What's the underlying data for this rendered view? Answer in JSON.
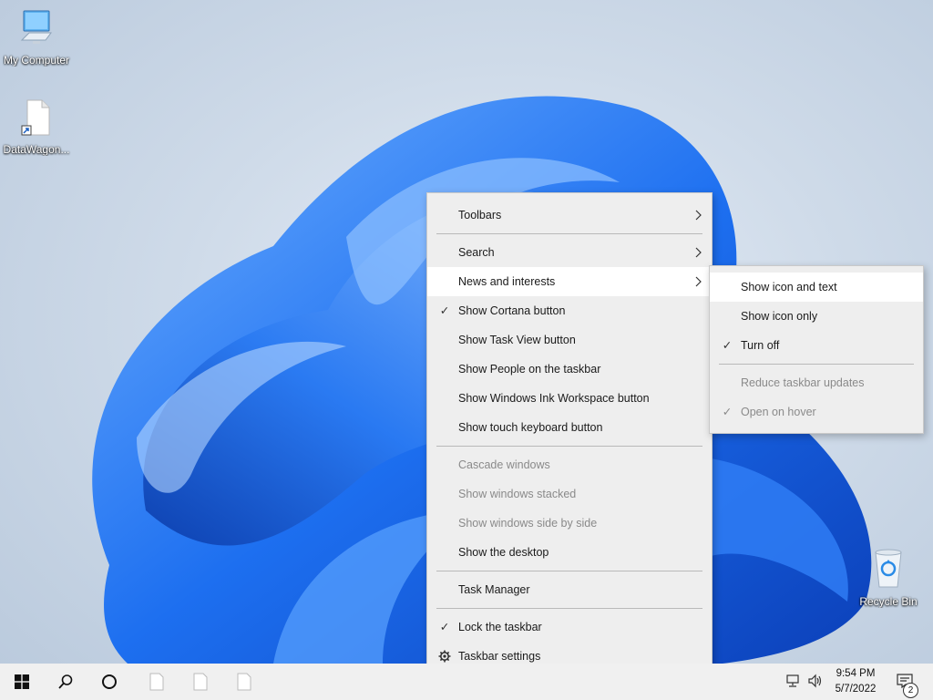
{
  "desktop": {
    "icons": [
      {
        "label": "My Computer",
        "icon": "computer-icon"
      },
      {
        "label": "DataWagon...",
        "icon": "document-shortcut-icon"
      },
      {
        "label": "Recycle Bin",
        "icon": "recycle-bin-icon"
      }
    ]
  },
  "context_menu": {
    "items": [
      {
        "label": "Toolbars",
        "submenu": true
      },
      {
        "label": "Search",
        "submenu": true
      },
      {
        "label": "News and interests",
        "submenu": true,
        "highlighted": true
      },
      {
        "label": "Show Cortana button",
        "checked": true
      },
      {
        "label": "Show Task View button"
      },
      {
        "label": "Show People on the taskbar"
      },
      {
        "label": "Show Windows Ink Workspace button"
      },
      {
        "label": "Show touch keyboard button"
      },
      {
        "label": "Cascade windows",
        "disabled": true
      },
      {
        "label": "Show windows stacked",
        "disabled": true
      },
      {
        "label": "Show windows side by side",
        "disabled": true
      },
      {
        "label": "Show the desktop"
      },
      {
        "label": "Task Manager"
      },
      {
        "label": "Lock the taskbar",
        "checked": true
      },
      {
        "label": "Taskbar settings",
        "icon": "gear-icon"
      }
    ]
  },
  "submenu": {
    "items": [
      {
        "label": "Show icon and text",
        "highlighted": true
      },
      {
        "label": "Show icon only"
      },
      {
        "label": "Turn off",
        "checked": true
      },
      {
        "label": "Reduce taskbar updates",
        "disabled": true
      },
      {
        "label": "Open on hover",
        "checked": true,
        "disabled": true
      }
    ]
  },
  "taskbar": {
    "clock_time": "9:54 PM",
    "clock_date": "5/7/2022",
    "notification_count": "2"
  },
  "colors": {
    "menu_bg": "#eeeeee",
    "menu_hot": "#ffffff",
    "taskbar_bg": "#f0f0f0",
    "bloom_blue": "#1565e8"
  }
}
